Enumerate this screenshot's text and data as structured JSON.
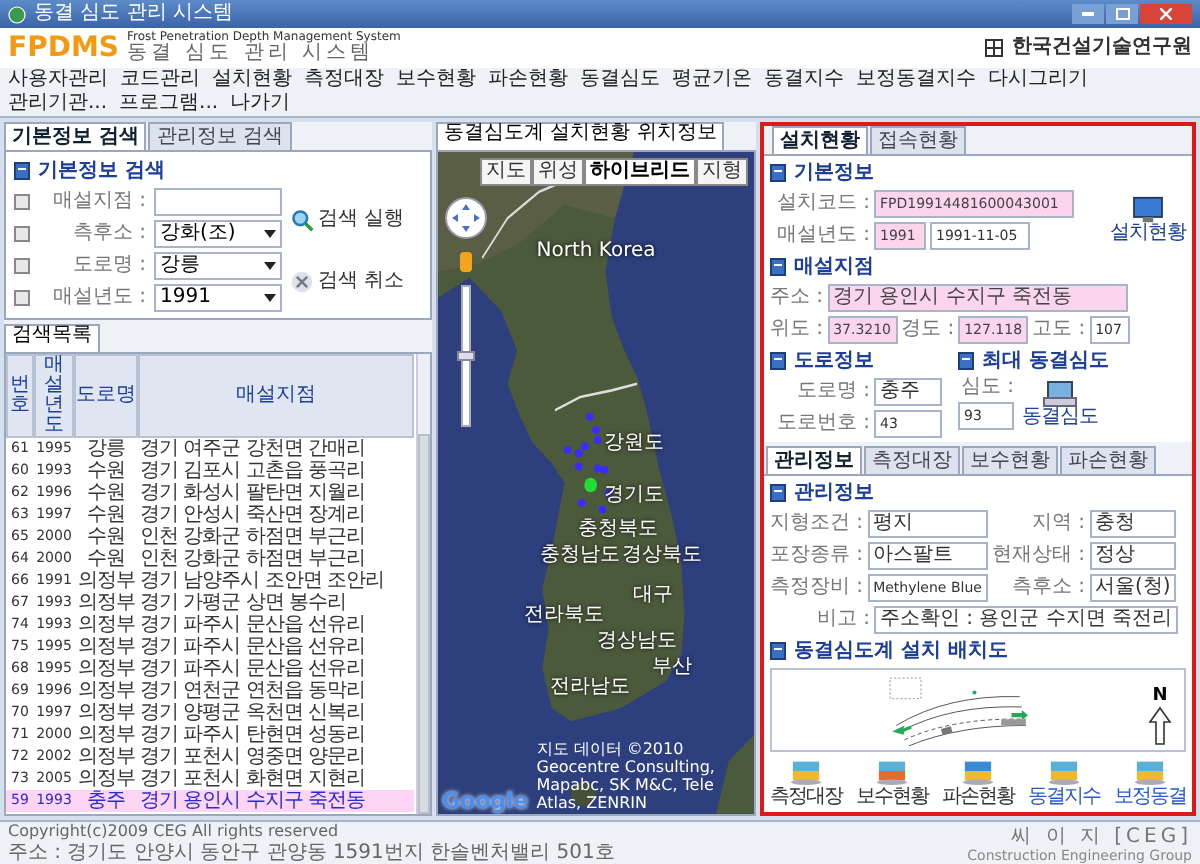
{
  "window": {
    "title": "동결 심도 관리 시스템"
  },
  "header": {
    "logo": "FPDMS",
    "subtitle": "Frost Penetration Depth Management System",
    "system_name": "동결 심도 관리 시스템",
    "institute": "한국건설기술연구원"
  },
  "menu": [
    {
      "label": "사용자관리"
    },
    {
      "label": "코드관리"
    },
    {
      "label": "설치현황"
    },
    {
      "label": "측정대장"
    },
    {
      "label": "보수현황"
    },
    {
      "label": "파손현황"
    },
    {
      "label": "동결심도"
    },
    {
      "label": "평균기온"
    },
    {
      "label": "동결지수"
    },
    {
      "label": "보정동결지수"
    },
    {
      "label": "다시그리기"
    },
    {
      "label": "관리기관..."
    },
    {
      "label": "프로그램..."
    },
    {
      "label": "나가기"
    }
  ],
  "left_panel": {
    "tabs": [
      {
        "label": "기본정보 검색",
        "selected": true
      },
      {
        "label": "관리정보 검색",
        "selected": false
      }
    ],
    "search": {
      "title": "기본정보 검색",
      "fields": [
        {
          "label": "매설지점 :",
          "checked": false,
          "kind": "text"
        },
        {
          "label": "측후소 :",
          "checked": false,
          "kind": "select",
          "value": "강화(조)"
        },
        {
          "label": "도로명 :",
          "checked": false,
          "kind": "select",
          "value": "강릉"
        },
        {
          "label": "매설년도 :",
          "checked": false,
          "kind": "select",
          "value": "1991"
        }
      ],
      "buttons": [
        "검색 실행",
        "검색 취소"
      ]
    },
    "list_tab": "검색목록",
    "table": {
      "columns": [
        "번호",
        "매설년도",
        "도로명",
        "매설지점"
      ],
      "rows": [
        {
          "cells": [
            "61",
            "1995",
            "강릉",
            "경기 여주군 강천면 간매리"
          ],
          "selected": false
        },
        {
          "cells": [
            "60",
            "1993",
            "수원",
            "경기 김포시 고촌읍 풍곡리"
          ],
          "selected": false
        },
        {
          "cells": [
            "62",
            "1996",
            "수원",
            "경기 화성시 팔탄면 지월리"
          ],
          "selected": false
        },
        {
          "cells": [
            "63",
            "1997",
            "수원",
            "경기 안성시 죽산면 장계리"
          ],
          "selected": false
        },
        {
          "cells": [
            "65",
            "2000",
            "수원",
            "인천 강화군 하점면 부근리"
          ],
          "selected": false
        },
        {
          "cells": [
            "64",
            "2000",
            "수원",
            "인천 강화군 하점면 부근리"
          ],
          "selected": false
        },
        {
          "cells": [
            "66",
            "1991",
            "의정부",
            "경기 남양주시 조안면 조안리"
          ],
          "selected": false
        },
        {
          "cells": [
            "67",
            "1993",
            "의정부",
            "경기 가평군 상면 봉수리"
          ],
          "selected": false
        },
        {
          "cells": [
            "74",
            "1993",
            "의정부",
            "경기 파주시 문산읍 선유리"
          ],
          "selected": false
        },
        {
          "cells": [
            "75",
            "1995",
            "의정부",
            "경기 파주시 문산읍 선유리"
          ],
          "selected": false
        },
        {
          "cells": [
            "68",
            "1995",
            "의정부",
            "경기 파주시 문산읍 선유리"
          ],
          "selected": false
        },
        {
          "cells": [
            "69",
            "1996",
            "의정부",
            "경기 연천군 연천읍 동막리"
          ],
          "selected": false
        },
        {
          "cells": [
            "70",
            "1997",
            "의정부",
            "경기 양평군 옥천면 신복리"
          ],
          "selected": false
        },
        {
          "cells": [
            "71",
            "2000",
            "의정부",
            "경기 파주시 탄현면 성동리"
          ],
          "selected": false
        },
        {
          "cells": [
            "72",
            "2002",
            "의정부",
            "경기 포천시 영중면 양문리"
          ],
          "selected": false
        },
        {
          "cells": [
            "73",
            "2005",
            "의정부",
            "경기 포천시 화현면 지현리"
          ],
          "selected": false
        },
        {
          "cells": [
            "59",
            "1993",
            "충주",
            "경기 용인시 수지구 죽전동"
          ],
          "selected": true
        }
      ]
    }
  },
  "map": {
    "tab": "동결심도계 설치현황 위치정보",
    "map_types": [
      {
        "label": "지도",
        "selected": false
      },
      {
        "label": "위성",
        "selected": false
      },
      {
        "label": "하이브리드",
        "selected": true
      },
      {
        "label": "지형",
        "selected": false
      }
    ],
    "labels": [
      "North Korea",
      "강원도",
      "경기도",
      "충청북도",
      "충청남도",
      "경상북도",
      "대구",
      "전라북도",
      "경상남도",
      "부산",
      "전라남도"
    ],
    "attribution": "지도 데이터 ©2010 Geocentre Consulting, Mapabc, SK M&C, Tele Atlas, ZENRIN",
    "logo": "Google"
  },
  "right_panel": {
    "tabs": [
      {
        "label": "설치현황",
        "selected": true
      },
      {
        "label": "접속현황",
        "selected": false
      }
    ],
    "basic": {
      "title": "기본정보",
      "code_label": "설치코드 :",
      "code": "FPD19914481600043001",
      "year_label": "매설년도 :",
      "year": "1991",
      "date": "1991-11-05",
      "button": "설치현황"
    },
    "location": {
      "title": "매설지점",
      "address_label": "주소 :",
      "address": "경기 용인시 수지구 죽전동",
      "lat_label": "위도 :",
      "lat": "37.3210",
      "lon_label": "경도 :",
      "lon": "127.118",
      "alt_label": "고도 :",
      "alt": "107"
    },
    "road": {
      "title": "도로정보",
      "name_label": "도로명 :",
      "name": "충주",
      "number_label": "도로번호 :",
      "number": "43"
    },
    "depth": {
      "title": "최대 동결심도",
      "depth_label": "심도 :",
      "depth": "93",
      "button": "동결심도"
    },
    "sub_tabs": [
      {
        "label": "관리정보",
        "selected": true
      },
      {
        "label": "측정대장",
        "selected": false
      },
      {
        "label": "보수현황",
        "selected": false
      },
      {
        "label": "파손현황",
        "selected": false
      }
    ],
    "management": {
      "title": "관리정보",
      "fields": [
        {
          "label": "지형조건 :",
          "value": "평지"
        },
        {
          "label": "지역 :",
          "value": "충청"
        },
        {
          "label": "포장종류 :",
          "value": "아스팔트"
        },
        {
          "label": "현재상태 :",
          "value": "정상"
        },
        {
          "label": "측정장비 :",
          "value": "Methylene Blue"
        },
        {
          "label": "측후소 :",
          "value": "서울(청)"
        }
      ],
      "note_label": "비고 :",
      "note": "주소확인 : 용인군 수지면 죽전리"
    },
    "layout": {
      "title": "동결심도계 설치 배치도",
      "north_label": "N"
    },
    "actions": [
      "측정대장",
      "보수현황",
      "파손현황",
      "동결지수",
      "보정동결"
    ]
  },
  "footer": {
    "copyright": "Copyright(c)2009 CEG All rights reserved",
    "address": "주소 : 경기도 안양시 동안구 관양동 1591번지 한솔벤처밸리 501호",
    "company": "씨 이 지 [CEG]",
    "company_sub": "Construction Engineering Group"
  }
}
